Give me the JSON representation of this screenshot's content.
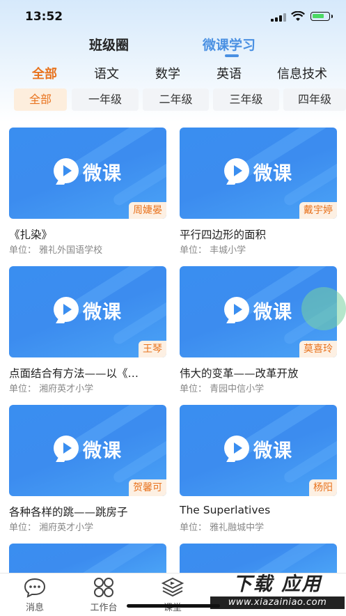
{
  "status": {
    "time": "13:52"
  },
  "top_tabs": [
    {
      "label": "班级圈",
      "active": false
    },
    {
      "label": "微课学习",
      "active": true
    }
  ],
  "subjects": [
    "全部",
    "语文",
    "数学",
    "英语",
    "信息技术"
  ],
  "subject_active": "全部",
  "grades": [
    "全部",
    "一年级",
    "二年级",
    "三年级",
    "四年级"
  ],
  "grade_active": "全部",
  "cover_text": "微课",
  "courses": [
    {
      "teacher": "周婕晏",
      "title": "《扎染》",
      "unit": "单位：  雅礼外国语学校"
    },
    {
      "teacher": "戴宇婷",
      "title": "平行四边形的面积",
      "unit": "单位：  丰城小学"
    },
    {
      "teacher": "王琴",
      "title": "点面结合有方法——以《…",
      "unit": "单位：  湘府英才小学"
    },
    {
      "teacher": "莫喜玲",
      "title": "伟大的变革——改革开放",
      "unit": "单位：  青园中信小学"
    },
    {
      "teacher": "贺馨可",
      "title": "各种各样的跳——跳房子",
      "unit": "单位：  湘府英才小学"
    },
    {
      "teacher": "杨阳",
      "title": "The Superlatives",
      "unit": "单位：  雅礼融城中学"
    }
  ],
  "bottom_nav": [
    {
      "label": "消息",
      "icon": "chat-bubble-icon"
    },
    {
      "label": "工作台",
      "icon": "grid-icon"
    },
    {
      "label": "课堂",
      "icon": "layers-play-icon"
    }
  ],
  "watermark": {
    "line1": "下载 应用",
    "line2": "www.xiazainiao.com"
  },
  "colors": {
    "accent": "#4a90e2",
    "orange": "#e8731e",
    "card_blue": "#3a8ef0"
  }
}
